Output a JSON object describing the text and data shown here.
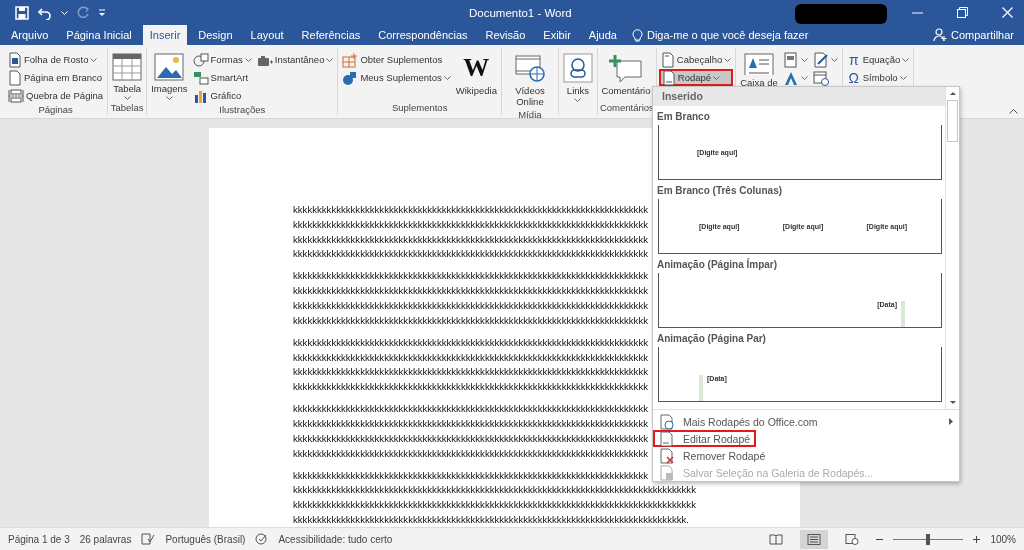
{
  "window": {
    "title": "Documento1 - Word"
  },
  "tabs": [
    {
      "label": "Arquivo",
      "selected": false
    },
    {
      "label": "Página Inicial",
      "selected": false
    },
    {
      "label": "Inserir",
      "selected": true
    },
    {
      "label": "Design",
      "selected": false
    },
    {
      "label": "Layout",
      "selected": false
    },
    {
      "label": "Referências",
      "selected": false
    },
    {
      "label": "Correspondências",
      "selected": false
    },
    {
      "label": "Revisão",
      "selected": false
    },
    {
      "label": "Exibir",
      "selected": false
    },
    {
      "label": "Ajuda",
      "selected": false
    }
  ],
  "tell_me": "Diga-me o que você deseja fazer",
  "share_button": "Compartilhar",
  "ribbon_groups": [
    {
      "label": "Páginas",
      "columns": [
        [
          {
            "kind": "small",
            "label": "Folha de Rosto",
            "dropdown": true,
            "highlighted": false
          },
          {
            "kind": "small",
            "label": "Página em Branco",
            "dropdown": false,
            "highlighted": false
          },
          {
            "kind": "small",
            "label": "Quebra de Página",
            "dropdown": false,
            "highlighted": false
          }
        ]
      ]
    },
    {
      "label": "Tabelas",
      "columns": [
        [
          {
            "kind": "large",
            "label": "Tabela",
            "dropdown": true,
            "highlighted": false
          }
        ]
      ]
    },
    {
      "label": "Ilustrações",
      "columns": [
        [
          {
            "kind": "large",
            "label": "Imagens",
            "dropdown": true,
            "highlighted": false
          }
        ],
        [
          {
            "kind": "small",
            "label": "Formas",
            "dropdown": true,
            "highlighted": false
          },
          {
            "kind": "small",
            "label": "SmartArt",
            "dropdown": false,
            "highlighted": false
          },
          {
            "kind": "small",
            "label": "Gráfico",
            "dropdown": false,
            "highlighted": false
          }
        ],
        [
          {
            "kind": "small",
            "label": "Instantâneo",
            "dropdown": true,
            "highlighted": false
          }
        ]
      ]
    },
    {
      "label": "Suplementos",
      "columns": [
        [
          {
            "kind": "small",
            "label": "Obter Suplementos",
            "dropdown": false,
            "highlighted": false
          },
          {
            "kind": "small",
            "label": "Meus Suplementos",
            "dropdown": true,
            "highlighted": false
          }
        ],
        [
          {
            "kind": "large",
            "label": "Wikipedia",
            "icon_text": "W",
            "dropdown": false,
            "highlighted": false
          }
        ]
      ]
    },
    {
      "label": "Mídia",
      "columns": [
        [
          {
            "kind": "large",
            "label": "Vídeos Online",
            "dropdown": false,
            "highlighted": false
          }
        ]
      ]
    },
    {
      "columns": [
        [
          {
            "kind": "large",
            "label": "Links",
            "dropdown": true,
            "highlighted": false
          }
        ]
      ]
    },
    {
      "label": "Comentários",
      "columns": [
        [
          {
            "kind": "large",
            "label": "Comentário",
            "dropdown": false,
            "highlighted": false
          }
        ]
      ]
    },
    {
      "columns": [
        [
          {
            "kind": "small",
            "label": "Cabeçalho",
            "dropdown": true,
            "highlighted": false
          },
          {
            "kind": "small",
            "label": "Rodapé",
            "dropdown": true,
            "highlighted": true
          }
        ]
      ]
    },
    {
      "columns": [
        [
          {
            "kind": "large",
            "label": "Caixa de",
            "dropdown": false,
            "highlighted": false
          }
        ],
        [
          {
            "kind": "icon",
            "dropdown": true,
            "highlighted": false
          },
          {
            "kind": "icon",
            "dropdown": true,
            "highlighted": false
          }
        ],
        [
          {
            "kind": "icon",
            "dropdown": true,
            "highlighted": false
          },
          {
            "kind": "icon",
            "dropdown": false,
            "highlighted": false
          }
        ]
      ]
    },
    {
      "columns": [
        [
          {
            "kind": "small",
            "label": "Equação",
            "icon_text": "π",
            "dropdown": true,
            "highlighted": false
          },
          {
            "kind": "small",
            "label": "Símbolo",
            "icon_text": "Ω",
            "dropdown": true,
            "highlighted": false
          }
        ]
      ]
    }
  ],
  "document": {
    "paragraphs": [
      [
        "kkkkkkkkkkkkkkkkkkkkkkkkkkkkkkkkkkkkkkkkkkkkkkkkkkkkkkkkkkkkkkkkkkkkkkkkkk",
        "kkkkkkkkkkkkkkkkkkkkkkkkkkkkkkkkkkkkkkkkkkkkkkkkkkkkkkkkkkkkkkkkkkkkkkkkkk",
        "kkkkkkkkkkkkkkkkkkkkkkkkkkkkkkkkkkkkkkkkkkkkkkkkkkkkkkkkkkkkkkkkkkkkkkkkkk",
        "kkkkkkkkkkkkkkkkkkkkkkkkkkkkkkkkkkkkkkkkkkkkkkkkkkkkkkkkkkkkkkkkkkkkkkkkkk"
      ],
      [
        "kkkkkkkkkkkkkkkkkkkkkkkkkkkkkkkkkkkkkkkkkkkkkkkkkkkkkkkkkkkkkkkkkkkkkkkkkk",
        "kkkkkkkkkkkkkkkkkkkkkkkkkkkkkkkkkkkkkkkkkkkkkkkkkkkkkkkkkkkkkkkkkkkkkkkkkk",
        "kkkkkkkkkkkkkkkkkkkkkkkkkkkkkkkkkkkkkkkkkkkkkkkkkkkkkkkkkkkkkkkkkkkkkkkkkk",
        "kkkkkkkkkkkkkkkkkkkkkkkkkkkkkkkkkkkkkkkkkkkkkkkkkkkkkkkkkkkkkkkkkkkkkkkkkk"
      ],
      [
        "kkkkkkkkkkkkkkkkkkkkkkkkkkkkkkkkkkkkkkkkkkkkkkkkkkkkkkkkkkkkkkkkkkkkkkkkkk",
        "kkkkkkkkkkkkkkkkkkkkkkkkkkkkkkkkkkkkkkkkkkkkkkkkkkkkkkkkkkkkkkkkkkkkkkkkkk",
        "kkkkkkkkkkkkkkkkkkkkkkkkkkkkkkkkkkkkkkkkkkkkkkkkkkkkkkkkkkkkkkkkkkkkkkkkkk",
        "kkkkkkkkkkkkkkkkkkkkkkkkkkkkkkkkkkkkkkkkkkkkkkkkkkkkkkkkkkkkkkkkkkkkkkkkkk"
      ],
      [
        "kkkkkkkkkkkkkkkkkkkkkkkkkkkkkkkkkkkkkkkkkkkkkkkkkkkkkkkkkkkkkkkkkkkkkkkkkk",
        "kkkkkkkkkkkkkkkkkkkkkkkkkkkkkkkkkkkkkkkkkkkkkkkkkkkkkkkkkkkkkkkkkkkkkkkkkk",
        "kkkkkkkkkkkkkkkkkkkkkkkkkkkkkkkkkkkkkkkkkkkkkkkkkkkkkkkkkkkkkkkkkkkkkkkkkk",
        "kkkkkkkkkkkkkkkkkkkkkkkkkkkkkkkkkkkkkkkkkkkkkkkkkkkkkkkkkkkkkkkkkkkkkkkkkk"
      ],
      [
        "kkkkkkkkkkkkkkkkkkkkkkkkkkkkkkkkkkkkkkkkkkkkkkkkkkkkkkkkkkkkkkkkkkkkkkkkkk",
        "kkkkkkkkkkkkkkkkkkkkkkkkkkkkkkkkkkkkkkkkkkkkkkkkkkkkkkkkkkkkkkkkkkkkkkkkkkkkkkkkkkkk",
        "kkkkkkkkkkkkkkkkkkkkkkkkkkkkkkkkkkkkkkkkkkkkkkkkkkkkkkkkkkkkkkkkkkkkkkkkkkkkkkkkkkkk",
        "kkkkkkkkkkkkkkkkkkkkkkkkkkkkkkkkkkkkkkkkkkkkkkkkkkkkkkkkkkkkkkkkkkkkkkkkkkkkkkkkkk."
      ]
    ]
  },
  "footer_menu": {
    "section": "Inserido",
    "gallery": [
      {
        "title": "Em Branco",
        "kind": "left",
        "placeholders": [
          "[Digite aqui]"
        ]
      },
      {
        "title": "Em Branco (Três Colunas)",
        "kind": "spread",
        "placeholders": [
          "[Digite aqui]",
          "[Digite aqui]",
          "[Digite aqui]"
        ]
      },
      {
        "title": "Animação (Página Ímpar)",
        "kind": "bar-right",
        "placeholders": [
          "[Data]"
        ]
      },
      {
        "title": "Animação (Página Par)",
        "kind": "bar-left",
        "placeholders": [
          "[Data]"
        ]
      }
    ],
    "commands": [
      {
        "label": "Mais Rodapés do Office.com",
        "submenu": true,
        "disabled": false,
        "highlighted": false
      },
      {
        "label": "Editar Rodapé",
        "submenu": false,
        "disabled": false,
        "highlighted": true
      },
      {
        "label": "Remover Rodapé",
        "submenu": false,
        "disabled": false,
        "highlighted": false
      },
      {
        "label": "Salvar Seleção na Galeria de Rodapés...",
        "submenu": false,
        "disabled": true,
        "highlighted": false
      }
    ]
  },
  "status_bar": {
    "items": [
      "Página 1 de 3",
      "26 palavras",
      "Português (Brasil)",
      "Acessibilidade: tudo certo"
    ],
    "views": [
      {
        "selected": false
      },
      {
        "selected": true
      },
      {
        "selected": false
      }
    ],
    "zoom": {
      "level": 0.5,
      "reading": "100%"
    }
  }
}
